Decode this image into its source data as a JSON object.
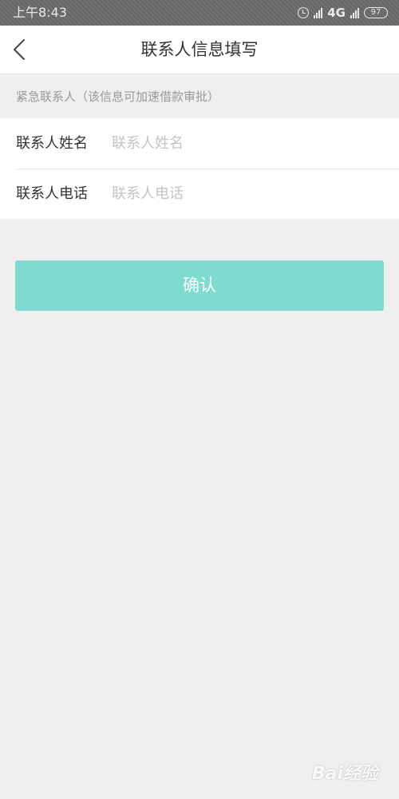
{
  "status_bar": {
    "time": "上午8:43",
    "network": "4G",
    "battery": "97",
    "icons": [
      "alarm-icon",
      "hd-signal-icon",
      "signal-icon",
      "battery-icon"
    ]
  },
  "header": {
    "title": "联系人信息填写",
    "back_icon": "chevron-left-icon"
  },
  "section": {
    "hint": "紧急联系人（该信息可加速借款审批）"
  },
  "form": {
    "name_label": "联系人姓名",
    "name_placeholder": "联系人姓名",
    "name_value": "",
    "phone_label": "联系人电话",
    "phone_placeholder": "联系人电话",
    "phone_value": ""
  },
  "confirm": {
    "label": "确认",
    "color": "#7fdbcf"
  },
  "watermark": {
    "text": "Bai经验"
  }
}
